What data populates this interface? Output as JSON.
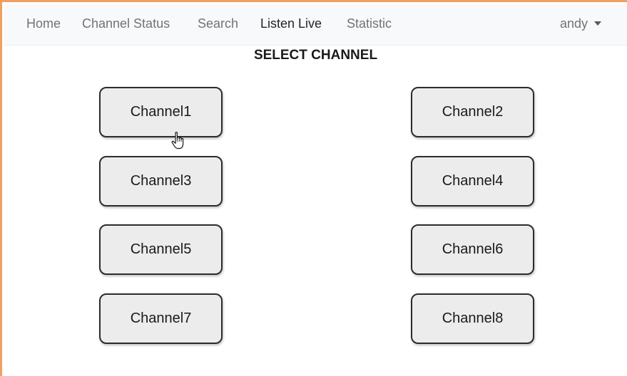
{
  "navbar": {
    "items": [
      {
        "label": "Home",
        "active": false
      },
      {
        "label": "Channel Status",
        "active": false
      },
      {
        "label": "Search",
        "active": false
      },
      {
        "label": "Listen Live",
        "active": true
      },
      {
        "label": "Statistic",
        "active": false
      }
    ],
    "user": {
      "label": "andy",
      "icon": "caret-down-icon"
    }
  },
  "page": {
    "title": "SELECT CHANNEL"
  },
  "channels": [
    {
      "label": "Channel1"
    },
    {
      "label": "Channel2"
    },
    {
      "label": "Channel3"
    },
    {
      "label": "Channel4"
    },
    {
      "label": "Channel5"
    },
    {
      "label": "Channel6"
    },
    {
      "label": "Channel7"
    },
    {
      "label": "Channel8"
    }
  ],
  "cursor": {
    "icon": "hand-cursor-icon"
  },
  "colors": {
    "window_border": "#f0a060",
    "navbar_bg": "#f8f9fa",
    "nav_text": "#6f7478",
    "nav_active_text": "#1f2326",
    "button_bg": "#ececec",
    "button_border": "#2c2c2c"
  }
}
